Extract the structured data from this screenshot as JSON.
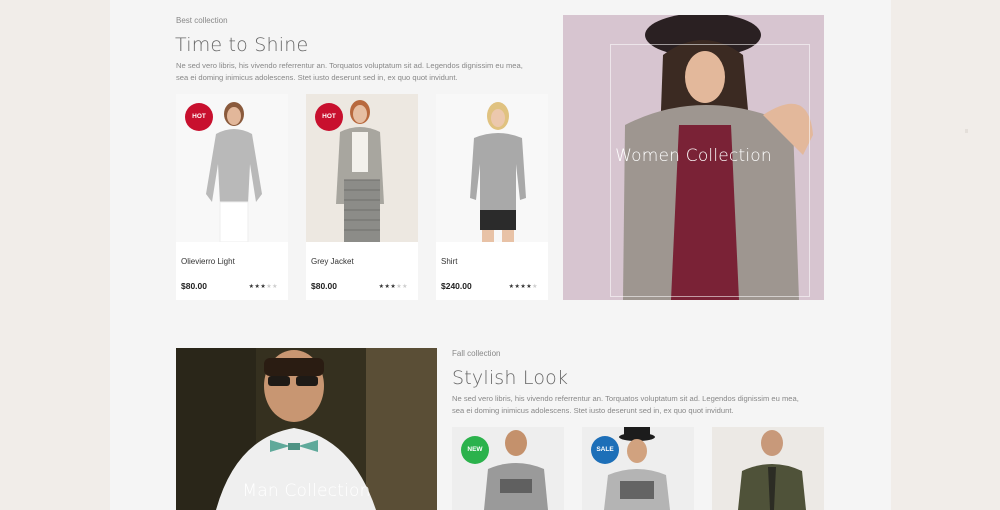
{
  "section1": {
    "eyebrow": "Best collection",
    "title": "Time to Shine",
    "description_line1": "Ne sed vero libris, his vivendo referrentur an. Torquatos voluptatum sit ad. Legendos dignissim eu mea,",
    "description_line2": "sea ei doming inimicus adolescens. Stet iusto deserunt sed in, ex quo quot invidunt.",
    "products": [
      {
        "name": "Olievierro Light",
        "price": "$80.00",
        "badge": "HOT",
        "badge_color": "#c8102e",
        "rating": 3
      },
      {
        "name": "Grey Jacket",
        "price": "$80.00",
        "badge": "HOT",
        "badge_color": "#c8102e",
        "rating": 3
      },
      {
        "name": "Shirt",
        "price": "$240.00",
        "badge": "",
        "rating": 4
      }
    ],
    "banner_label": "Women Collection"
  },
  "section2": {
    "eyebrow": "Fall collection",
    "title": "Stylish Look",
    "description_line1": "Ne sed vero libris, his vivendo referrentur an. Torquatos voluptatum sit ad. Legendos dignissim eu mea,",
    "description_line2": "sea ei doming inimicus adolescens. Stet iusto deserunt sed in, ex quo quot invidunt.",
    "banner_label": "Man Collection",
    "products": [
      {
        "badge": "NEW",
        "badge_color": "#2bb24c"
      },
      {
        "badge": "SALE",
        "badge_color": "#1d6fb8"
      },
      {
        "badge": ""
      }
    ]
  },
  "stars": {
    "on": "★",
    "off": "★"
  }
}
